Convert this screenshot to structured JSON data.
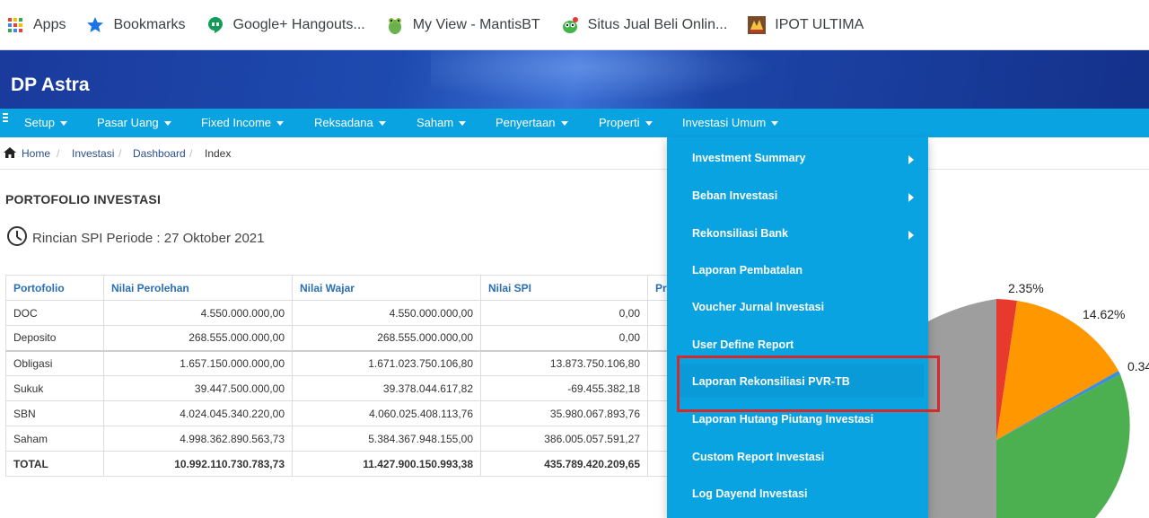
{
  "bookmarks": [
    {
      "label": "Apps",
      "icon": "apps-grid-icon"
    },
    {
      "label": "Bookmarks",
      "icon": "star-icon"
    },
    {
      "label": "Google+ Hangouts...",
      "icon": "hangouts-icon"
    },
    {
      "label": "My View - MantisBT",
      "icon": "mantis-icon"
    },
    {
      "label": "Situs Jual Beli Onlin...",
      "icon": "shop-icon"
    },
    {
      "label": "IPOT ULTIMA",
      "icon": "ipot-icon"
    }
  ],
  "header": {
    "brand": "DP Astra"
  },
  "menu": [
    {
      "label": "Setup"
    },
    {
      "label": "Pasar Uang"
    },
    {
      "label": "Fixed Income"
    },
    {
      "label": "Reksadana"
    },
    {
      "label": "Saham"
    },
    {
      "label": "Penyertaan"
    },
    {
      "label": "Properti"
    },
    {
      "label": "Investasi Umum"
    }
  ],
  "breadcrumb": [
    "Home",
    "Investasi",
    "Dashboard",
    "Index"
  ],
  "page": {
    "title": "PORTOFOLIO INVESTASI",
    "period": "Rincian SPI Periode : 27 Oktober 2021"
  },
  "table": {
    "headers": [
      "Portofolio",
      "Nilai Perolehan",
      "Nilai Wajar",
      "Nilai SPI",
      "Pro"
    ],
    "rows": [
      [
        "DOC",
        "4.550.000.000,00",
        "4.550.000.000,00",
        "0,00"
      ],
      [
        "Deposito",
        "268.555.000.000,00",
        "268.555.000.000,00",
        "0,00"
      ],
      [
        "Obligasi",
        "1.657.150.000.000,00",
        "1.671.023.750.106,80",
        "13.873.750.106,80"
      ],
      [
        "Sukuk",
        "39.447.500.000,00",
        "39.378.044.617,82",
        "-69.455.382,18"
      ],
      [
        "SBN",
        "4.024.045.340.220,00",
        "4.060.025.408.113,76",
        "35.980.067.893,76"
      ],
      [
        "Saham",
        "4.998.362.890.563,73",
        "5.384.367.948.155,00",
        "386.005.057.591,27"
      ],
      [
        "TOTAL",
        "10.992.110.730.783,73",
        "11.427.900.150.993,38",
        "435.789.420.209,65"
      ]
    ]
  },
  "dropdown": [
    {
      "label": "Investment Summary",
      "submenu": true
    },
    {
      "label": "Beban Investasi",
      "submenu": true
    },
    {
      "label": "Rekonsiliasi Bank",
      "submenu": true
    },
    {
      "label": "Laporan Pembatalan",
      "submenu": false
    },
    {
      "label": "Voucher Jurnal Investasi",
      "submenu": false
    },
    {
      "label": "User Define Report",
      "submenu": false
    },
    {
      "label": "Laporan Rekonsiliasi PVR-TB",
      "submenu": false
    },
    {
      "label": "Laporan Hutang Piutang Investasi",
      "submenu": false
    },
    {
      "label": "Custom Report Investasi",
      "submenu": false
    },
    {
      "label": "Log Dayend Investasi",
      "submenu": false
    }
  ],
  "pie": {
    "labels": [
      "2.35%",
      "14.62%",
      "0.34"
    ],
    "colors": {
      "red": "#e8392f",
      "orange": "#ff9800",
      "blue": "#3b8fd9",
      "green": "#4caf50",
      "gray": "#9e9e9e"
    }
  }
}
